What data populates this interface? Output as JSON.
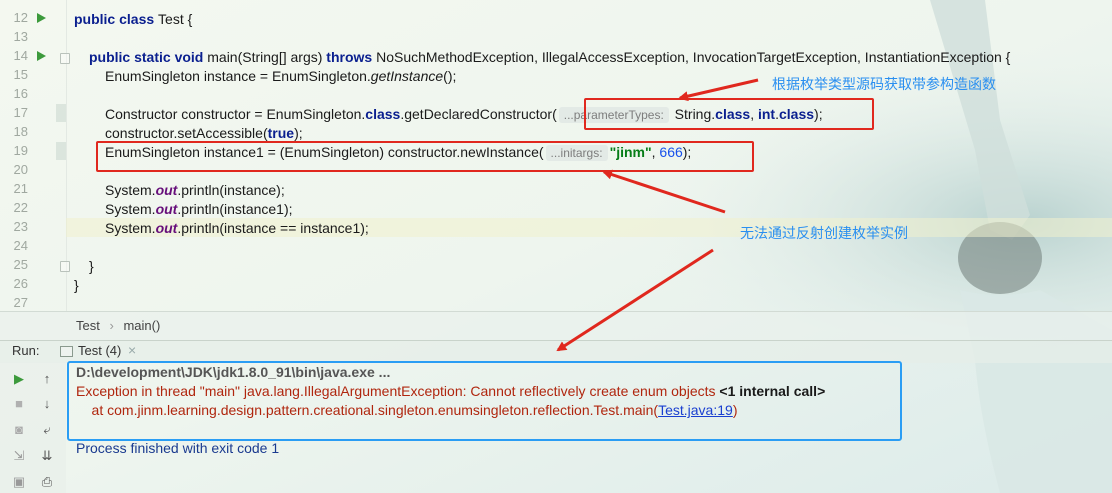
{
  "editor": {
    "line_numbers": [
      "12",
      "13",
      "14",
      "15",
      "16",
      "17",
      "18",
      "19",
      "20",
      "21",
      "22",
      "23",
      "24",
      "25",
      "26",
      "27"
    ],
    "lines": {
      "l12": {
        "kw1": "public class ",
        "name": "Test {"
      },
      "l14": {
        "kw1": "public static void ",
        "sig": "main(String[] args) ",
        "kw2": "throws ",
        "ex": "NoSuchMethodException, IllegalAccessException, InvocationTargetException, InstantiationException {"
      },
      "l15": {
        "a": "EnumSingleton instance = EnumSingleton.",
        "b": "getInstance",
        "c": "();"
      },
      "l17": {
        "a": "Constructor constructor = EnumSingleton.",
        "kw": "class",
        ".b": "",
        "b": ".getDeclaredConstructor(",
        "hint": "...parameterTypes:",
        "c": " String.",
        "kw2": "class",
        ", ": ", ",
        "kw3": "int",
        "d": ".",
        "kw4": "class",
        "e": ");"
      },
      "l18": {
        "a": "constructor.setAccessible(",
        "kw": "true",
        "b": ");"
      },
      "l19": {
        "a": "EnumSingleton instance1 = (EnumSingleton) constructor.newInstance(",
        "hint": "...initargs:",
        "s": "\"jinm\"",
        "b": ", ",
        "n": "666",
        "c": ");"
      },
      "l21": {
        "a": "System.",
        "f": "out",
        "b": ".println(instance);"
      },
      "l22": {
        "a": "System.",
        "f": "out",
        "b": ".println(instance1);"
      },
      "l23": {
        "a": "System.",
        "f": "out",
        "b": ".println(instance == instance1);"
      },
      "l25": {
        "a": "}"
      },
      "l26": {
        "a": "}"
      }
    }
  },
  "breadcrumb": [
    "Test",
    "main()"
  ],
  "run": {
    "label": "Run:",
    "tab": "Test (4)",
    "close": "×",
    "output": {
      "cmd": "D:\\development\\JDK\\jdk1.8.0_91\\bin\\java.exe ...",
      "exception": "Exception in thread \"main\" java.lang.IllegalArgumentException: Cannot reflectively create enum objects ",
      "internal": "<1 internal call>",
      "at_prefix": "    at com.jinm.learning.design.pattern.creational.singleton.enumsingleton.reflection.Test.main(",
      "at_link": "Test.java:19",
      "at_suffix": ")",
      "finished": "Process finished with exit code 1"
    }
  },
  "annotations": {
    "top": "根据枚举类型源码获取带参构造函数",
    "middle": "无法通过反射创建枚举实例"
  },
  "colors": {
    "red": "#e0281e",
    "blue": "#2a9df4",
    "keyword": "#0a1f8f",
    "string": "#067d17",
    "number": "#1750eb"
  }
}
